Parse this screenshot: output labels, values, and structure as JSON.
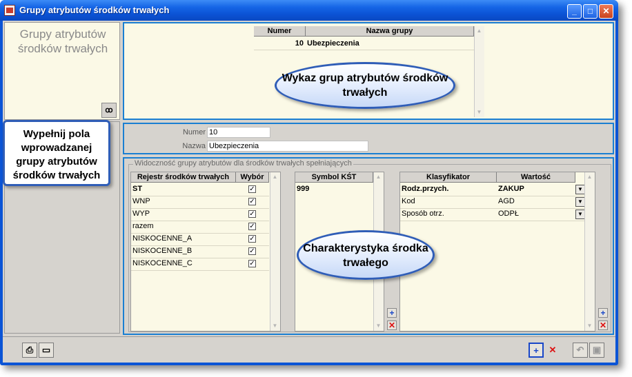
{
  "window": {
    "title": "Grupy atrybutów środków trwałych",
    "controls": {
      "minimize": "_",
      "maximize": "□",
      "close": "✕"
    }
  },
  "left_panel": {
    "title": "Grupy atrybutów środków trwałych",
    "search_icon": "binoculars-icon"
  },
  "groups_grid": {
    "columns": [
      "Numer",
      "Nazwa grupy"
    ],
    "rows": [
      {
        "numer": "10",
        "nazwa": "Ubezpieczenia"
      }
    ]
  },
  "fields": {
    "numer_label": "Numer",
    "numer_value": "10",
    "nazwa_label": "Nazwa",
    "nazwa_value": "Ubezpieczenia"
  },
  "visibility": {
    "group_label": "Widoczność grupy atrybutów dla środków trwałych spełniających",
    "registers": {
      "columns": [
        "Rejestr środków trwałych",
        "Wybór"
      ],
      "rows": [
        {
          "name": "ST",
          "checked": "✓"
        },
        {
          "name": "WNP",
          "checked": "✓"
        },
        {
          "name": "WYP",
          "checked": "✓"
        },
        {
          "name": "razem",
          "checked": "✓"
        },
        {
          "name": "NISKOCENNE_A",
          "checked": "✓"
        },
        {
          "name": "NISKOCENNE_B",
          "checked": "✓"
        },
        {
          "name": "NISKOCENNE_C",
          "checked": "✓"
        }
      ]
    },
    "kst": {
      "columns": [
        "Symbol KŚT"
      ],
      "rows": [
        "999"
      ]
    },
    "classifiers": {
      "columns": [
        "Klasyfikator",
        "Wartość"
      ],
      "rows": [
        {
          "name": "Rodz.przych.",
          "value": "ZAKUP"
        },
        {
          "name": "Kod",
          "value": "AGD"
        },
        {
          "name": "Sposób otrz.",
          "value": "ODPŁ"
        }
      ]
    },
    "add_symbol": "+",
    "delete_symbol": "✕"
  },
  "footer": {
    "print_icon": "printer-icon",
    "preview_icon": "monitor-icon",
    "add_symbol": "+",
    "delete_symbol": "✕",
    "undo_icon": "undo-icon",
    "save_icon": "save-icon"
  },
  "callouts": {
    "list": "Wykaz grup atrybutów środków trwałych",
    "fields": "Wypełnij pola wprowadzanej grupy atrybutów środków trwałych",
    "characteristics": "Charakterystyka środka trwałego"
  },
  "colors": {
    "titlebar": "#0b52d4",
    "panel_border": "#1a7fd2",
    "grid_bg": "#fbf9e6",
    "callout_border": "#2f5db7"
  }
}
